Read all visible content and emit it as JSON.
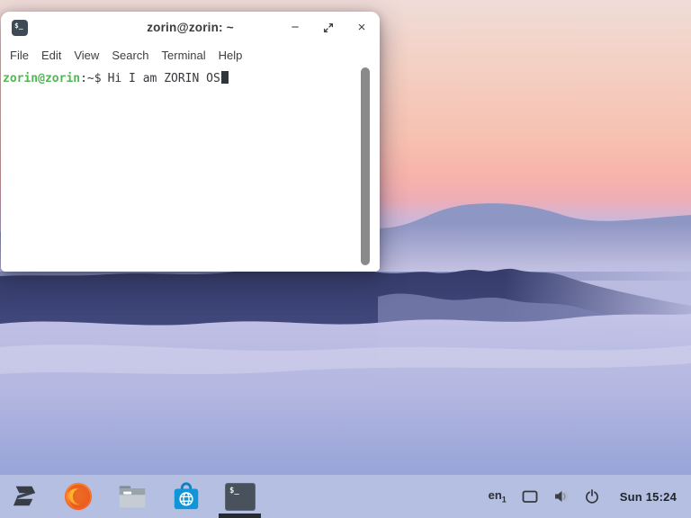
{
  "terminal_window": {
    "title": "zorin@zorin: ~",
    "icon_glyph": "$_",
    "menu_items": [
      "File",
      "Edit",
      "View",
      "Search",
      "Terminal",
      "Help"
    ],
    "prompt": {
      "user_host": "zorin@zorin",
      "path_suffix": ":~$",
      "command": "Hi I am ZORIN OS"
    },
    "controls": {
      "minimize_glyph": "−",
      "close_glyph": "×"
    }
  },
  "taskbar": {
    "apps": [
      {
        "id": "zorin-menu",
        "icon": "zorin-logo"
      },
      {
        "id": "firefox",
        "icon": "firefox"
      },
      {
        "id": "files",
        "icon": "folder"
      },
      {
        "id": "software",
        "icon": "software-store"
      },
      {
        "id": "terminal",
        "icon": "terminal",
        "active": true,
        "glyph": "$_"
      }
    ],
    "status": {
      "language": "en",
      "language_sub": "1"
    },
    "clock": "Sun 15:24"
  },
  "colors": {
    "taskbar_bg": "#b4bfe2",
    "terminal_bg": "#ffffff",
    "prompt_green": "#53b656",
    "terminal_text": "#36383c",
    "software_blue": "#1095d8",
    "sky_top": "#efdcd8",
    "sky_pink": "#f7b3ab",
    "mist_bottom": "#8c9ed6",
    "dark_ridge": "#39406e"
  }
}
